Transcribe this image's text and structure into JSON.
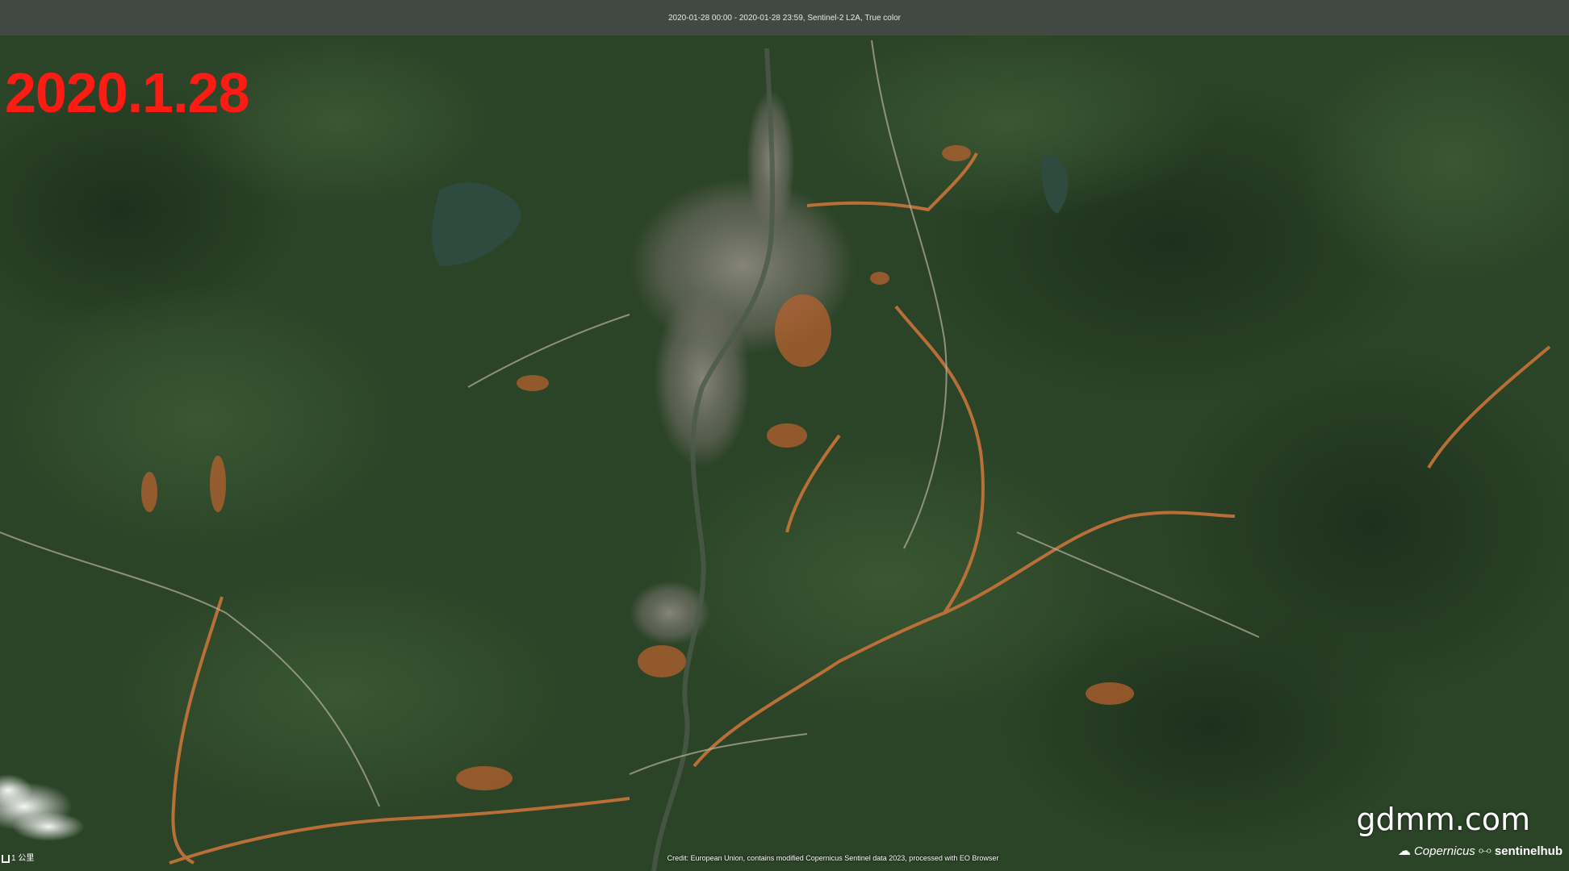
{
  "header": {
    "info": "2020-01-28 00:00 - 2020-01-28 23:59, Sentinel-2 L2A, True color"
  },
  "overlay": {
    "date_stamp": "2020.1.28",
    "watermark": "gdmm.com"
  },
  "footer": {
    "credit": "Credit: European Union, contains modified Copernicus Sentinel data 2023, processed with EO Browser",
    "scale_label": "1 公里",
    "logo_copernicus": "Copernicus",
    "logo_sentinelhub": "sentinelhub"
  },
  "colors": {
    "date_stamp": "#ff1a14",
    "forest": "#2c4a2a",
    "bare_soil": "#b5622f",
    "urban": "#8c8a80",
    "water": "#2f4a3e"
  },
  "icons": [
    "scale-bar-icon",
    "copernicus-logo-icon",
    "sentinelhub-logo-icon"
  ]
}
